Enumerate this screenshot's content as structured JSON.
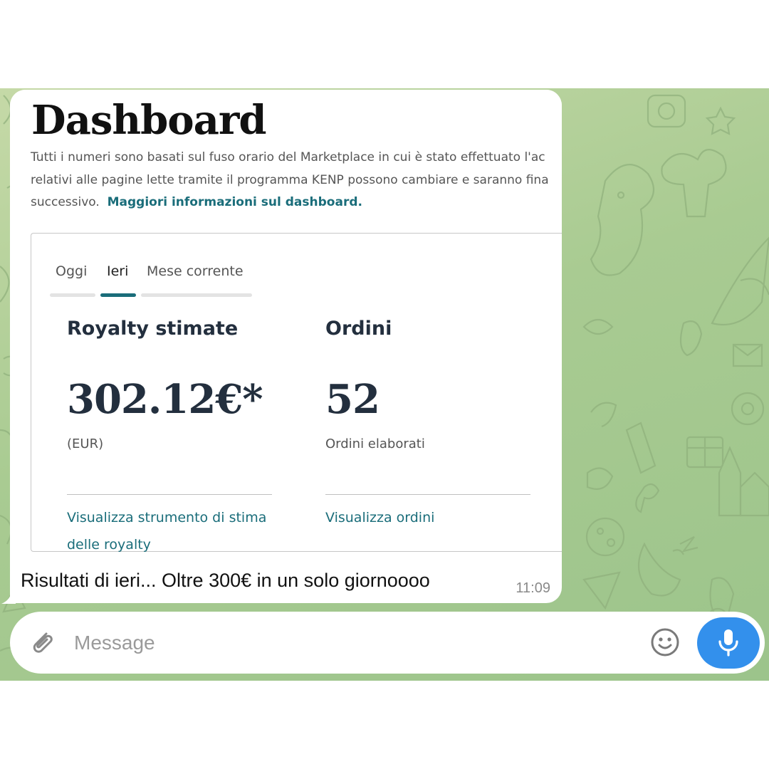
{
  "screenshot": {
    "title": "Dashboard",
    "description_lines": [
      "Tutti i numeri sono basati sul fuso orario del Marketplace in cui è stato effettuato l'ac",
      "relativi alle pagine lette tramite il programma KENP possono cambiare e saranno fina",
      "successivo."
    ],
    "info_link": "Maggiori informazioni sul dashboard.",
    "tabs": [
      {
        "label": "Oggi",
        "active": false
      },
      {
        "label": "Ieri",
        "active": true
      },
      {
        "label": "Mese corrente",
        "active": false
      }
    ],
    "royalty": {
      "label": "Royalty stimate",
      "value": "302.12€*",
      "sub": "(EUR)",
      "link_lines": [
        "Visualizza strumento di stima",
        "delle royalty"
      ]
    },
    "orders": {
      "label": "Ordini",
      "value": "52",
      "sub": "Ordini elaborati",
      "link": "Visualizza ordini"
    }
  },
  "message": {
    "caption": "Risultati di ieri... Oltre 300€ in un solo giornoooo",
    "time": "11:09"
  },
  "composer": {
    "placeholder": "Message",
    "attach_icon": "paperclip-icon",
    "emoji_icon": "smiley-icon",
    "mic_icon": "microphone-icon"
  },
  "colors": {
    "accent": "#3390ec",
    "kdp_teal": "#1a6d7a",
    "chat_background": "#b4d19b"
  }
}
